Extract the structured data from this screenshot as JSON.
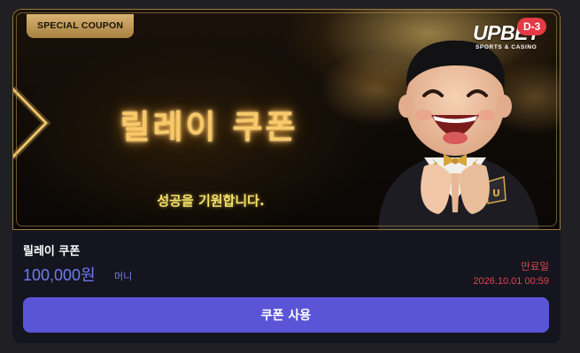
{
  "coupon": {
    "tag_label": "SPECIAL COUPON",
    "banner_title": "릴레이 쿠폰",
    "banner_subtitle": "성공을 기원합니다.",
    "logo_text": "UPBET",
    "logo_subtext": "SPORTS & CASINO",
    "dday_badge": "D-3",
    "name": "릴레이 쿠폰",
    "amount": "100,000원",
    "amount_unit": "머니",
    "expiry_label": "만료일",
    "expiry_date": "2026.10.01 00:59",
    "use_button_label": "쿠폰 사용"
  },
  "colors": {
    "accent": "#5a55d6",
    "amount": "#6f7df0",
    "expiry": "#e0454f",
    "badge": "#e43a46",
    "gold": "#d8b272"
  },
  "icons": {
    "mascot": "laughing-mascot-illustration",
    "chevron": "gold-chevron-right"
  }
}
